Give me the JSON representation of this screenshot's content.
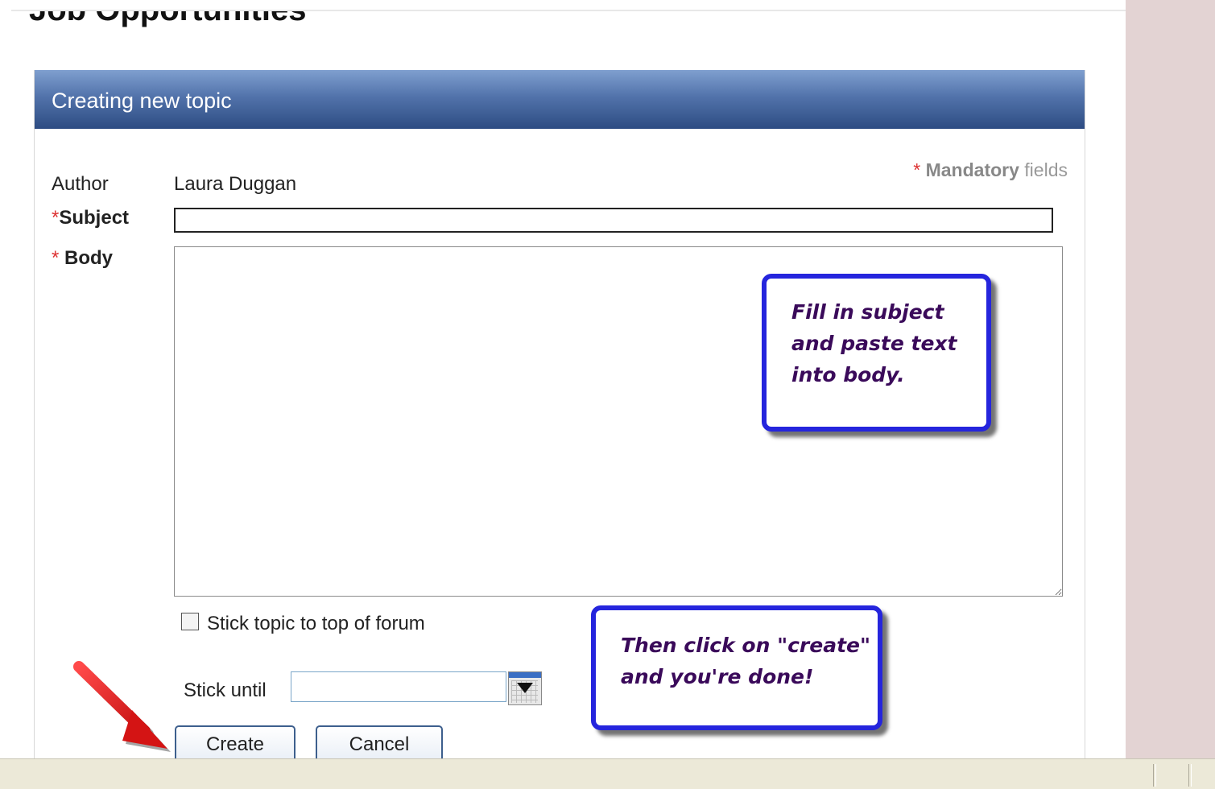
{
  "page": {
    "heading": "Job Opportunities"
  },
  "panel": {
    "title": "Creating new topic",
    "mandatory": {
      "star": "*",
      "bold": "Mandatory",
      "rest": "fields"
    }
  },
  "form": {
    "author_label": "Author",
    "author_value": "Laura Duggan",
    "subject_star": "*",
    "subject_label": "Subject",
    "subject_value": "",
    "body_star": "*",
    "body_label": "Body",
    "body_value": "",
    "stick_label": "Stick topic to top of forum",
    "stick_checked": false,
    "stick_until_label": "Stick until",
    "stick_until_value": "",
    "create_label": "Create",
    "cancel_label": "Cancel"
  },
  "annotations": {
    "callout_1": [
      "Fill in subject",
      "and paste text",
      "into body."
    ],
    "callout_2": [
      "Then click on \"create\"",
      "and you're done!"
    ],
    "arrow_color": "#e01b1b",
    "callout_border_color": "#2525dd"
  },
  "icons": {
    "calendar": "calendar-dropdown-icon",
    "pointer": "red-arrow-icon"
  }
}
